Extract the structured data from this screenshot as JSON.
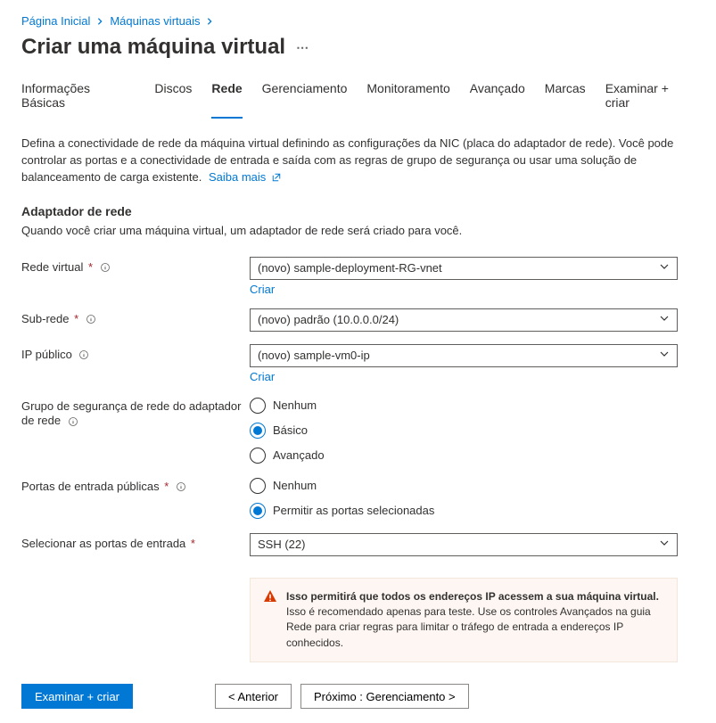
{
  "breadcrumb": {
    "home": "Página Inicial",
    "vms": "Máquinas virtuais"
  },
  "page_title": "Criar uma máquina virtual",
  "tabs": {
    "basics": "Informações Básicas",
    "disks": "Discos",
    "network": "Rede",
    "management": "Gerenciamento",
    "monitoring": "Monitoramento",
    "advanced": "Avançado",
    "tags": "Marcas",
    "review": "Examinar + criar"
  },
  "description": "Defina a conectividade de rede da máquina virtual definindo as configurações da NIC (placa do adaptador de rede). Você pode controlar as portas e a conectividade de entrada e saída com as regras de grupo de segurança ou usar uma solução de balanceamento de carga existente.",
  "learn_more": "Saiba mais",
  "section": {
    "title": "Adaptador de rede",
    "subtext": "Quando você criar uma máquina virtual, um adaptador de rede será criado para você."
  },
  "fields": {
    "vnet": {
      "label": "Rede virtual",
      "value": "(novo) sample-deployment-RG-vnet",
      "create": "Criar"
    },
    "subnet": {
      "label": "Sub-rede",
      "value": "(novo) padrão (10.0.0.0/24)"
    },
    "public_ip": {
      "label": "IP público",
      "value": "(novo) sample-vm0-ip",
      "create": "Criar"
    },
    "nsg": {
      "label": "Grupo de segurança de rede do adaptador de rede",
      "options": {
        "none": "Nenhum",
        "basic": "Básico",
        "advanced": "Avançado"
      }
    },
    "inbound_ports": {
      "label": "Portas de entrada públicas",
      "options": {
        "none": "Nenhum",
        "allow": "Permitir as portas selecionadas"
      }
    },
    "select_ports": {
      "label": "Selecionar as portas de entrada",
      "value": "SSH (22)"
    }
  },
  "warning": {
    "bold": "Isso permitirá que todos os endereços IP acessem a sua máquina virtual.",
    "text": " Isso é recomendado apenas para teste. Use os controles Avançados na guia Rede para criar regras para limitar o tráfego de entrada a endereços IP conhecidos."
  },
  "buttons": {
    "review": "Examinar + criar",
    "previous": "<  Anterior",
    "next": "Próximo : Gerenciamento  >"
  }
}
